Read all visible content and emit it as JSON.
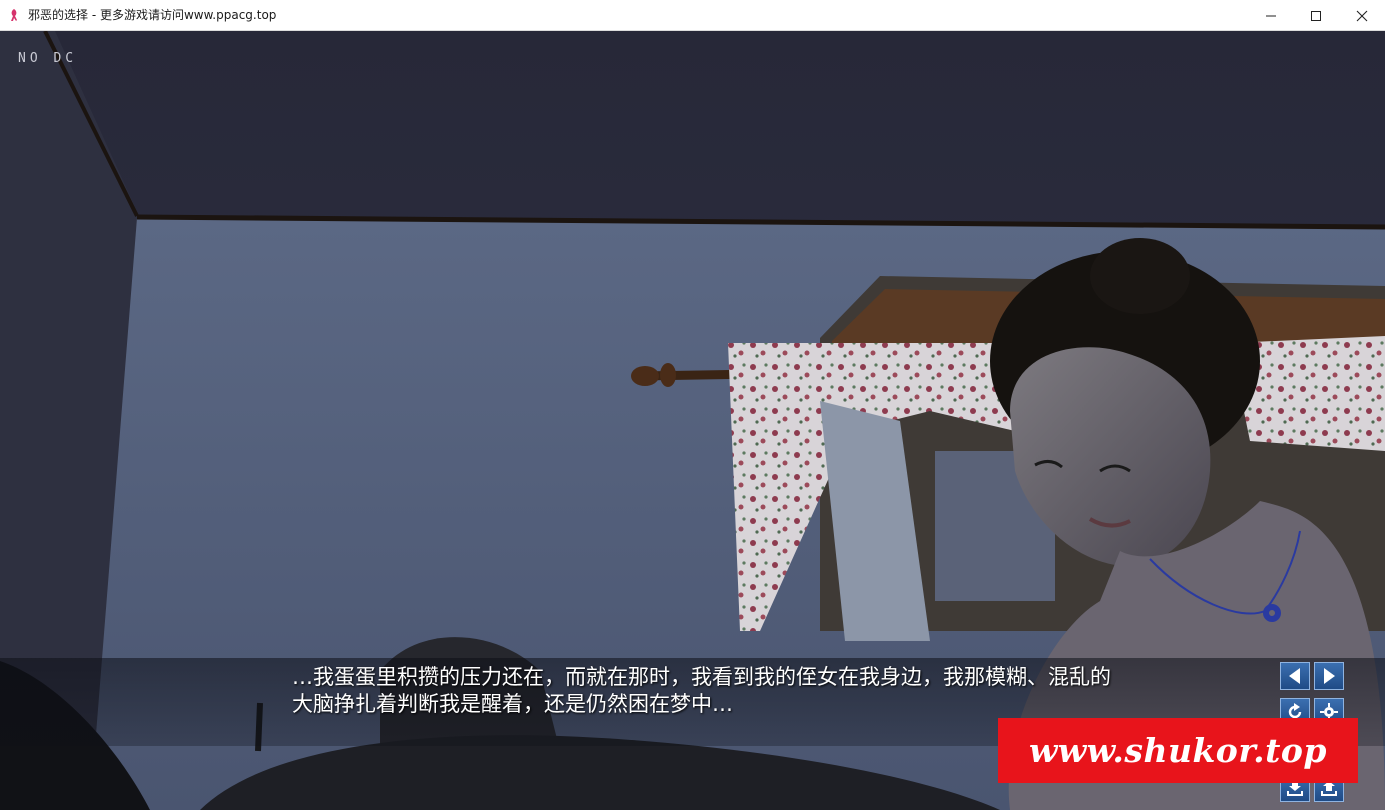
{
  "window": {
    "title": "邪恶的选择 - 更多游戏请访问www.ppacg.top",
    "controls": [
      "minimize",
      "maximize",
      "close"
    ]
  },
  "scene": {
    "debug_label": "NO DC"
  },
  "dialogue": {
    "text": "…我蛋蛋里积攒的压力还在，而就在那时，我看到我的侄女在我身边，我那模糊、混乱的大脑挣扎着判断我是醒着，还是仍然困在梦中…"
  },
  "controls": [
    {
      "name": "previous-button",
      "icon": "arrow-left-icon"
    },
    {
      "name": "next-button",
      "icon": "arrow-right-icon"
    },
    {
      "name": "auto-button",
      "icon": "refresh-icon"
    },
    {
      "name": "settings-button",
      "icon": "gear-icon"
    },
    {
      "name": "save-button",
      "icon": "download-icon"
    },
    {
      "name": "load-button",
      "icon": "upload-icon"
    }
  ],
  "watermark": {
    "text": "www.shukor.top",
    "color": "#e8141b"
  }
}
